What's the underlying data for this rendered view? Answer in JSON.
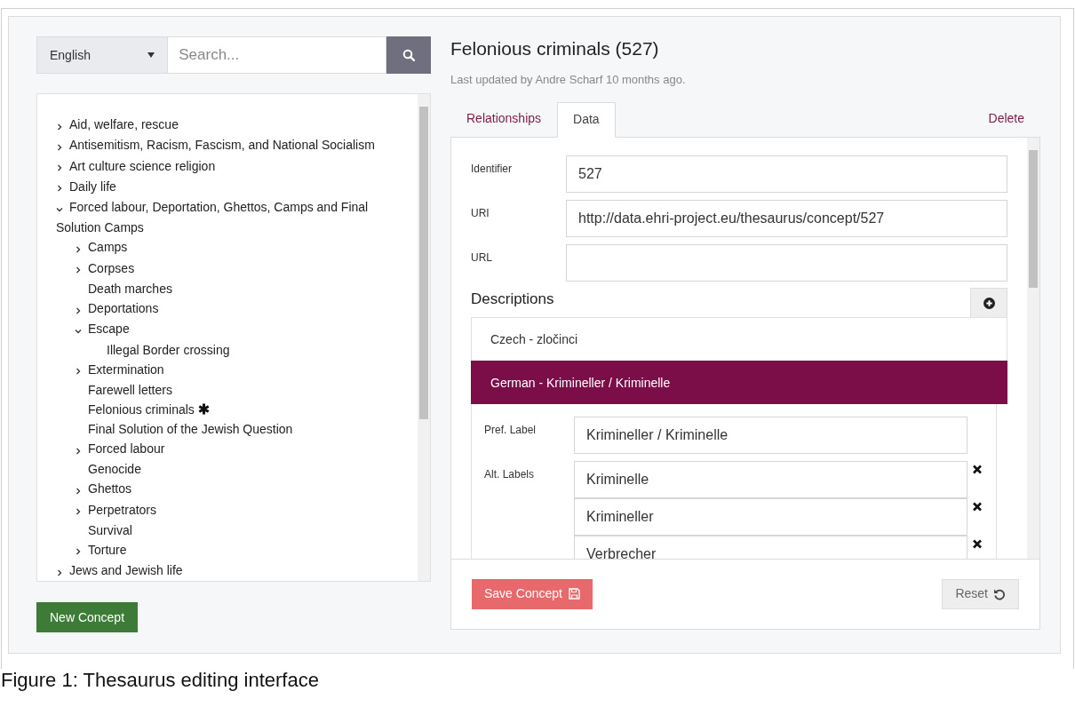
{
  "language_select": {
    "value": "English"
  },
  "search": {
    "placeholder": "Search..."
  },
  "tree": [
    {
      "label": "Aid, welfare, rescue",
      "expanded": false
    },
    {
      "label": "Antisemitism, Racism, Fascism, and National Socialism",
      "expanded": false
    },
    {
      "label": "Art culture science religion",
      "expanded": false
    },
    {
      "label": "Daily life",
      "expanded": false
    },
    {
      "label": "Forced labour, Deportation, Ghettos, Camps and Final Solution Camps",
      "expanded": true,
      "children": [
        {
          "label": "Camps",
          "expanded": false
        },
        {
          "label": "Corpses",
          "expanded": false
        },
        {
          "label": "Death marches"
        },
        {
          "label": "Deportations",
          "expanded": false
        },
        {
          "label": "Escape",
          "expanded": true,
          "children": [
            {
              "label": "Illegal Border crossing"
            }
          ]
        },
        {
          "label": "Extermination",
          "expanded": false
        },
        {
          "label": "Farewell letters"
        },
        {
          "label": "Felonious criminals",
          "current": true
        },
        {
          "label": "Final Solution of the Jewish Question"
        },
        {
          "label": "Forced labour",
          "expanded": false
        },
        {
          "label": "Genocide"
        },
        {
          "label": "Ghettos",
          "expanded": false
        },
        {
          "label": "Perpetrators",
          "expanded": false
        },
        {
          "label": "Survival"
        },
        {
          "label": "Torture",
          "expanded": false
        }
      ]
    },
    {
      "label": "Jews and Jewish life",
      "expanded": false
    }
  ],
  "new_concept_button": "New Concept",
  "concept": {
    "title": "Felonious criminals (527)",
    "updated": "Last updated by Andre Scharf 10 months ago."
  },
  "tabs": [
    {
      "label": "Relationships",
      "selected": false
    },
    {
      "label": "Data",
      "selected": true
    }
  ],
  "delete_link": "Delete",
  "fields": [
    {
      "label": "Identifier",
      "value": "527"
    },
    {
      "label": "URI",
      "value": "http://data.ehri-project.eu/thesaurus/concept/527"
    },
    {
      "label": "URL"
    }
  ],
  "descriptions": {
    "heading": "Descriptions",
    "items": [
      {
        "label": "Czech - zločinci",
        "selected": false
      },
      {
        "label": "German - Krimineller / Kriminelle",
        "selected": true,
        "pref_label": {
          "label": "Pref. Label",
          "value": "Krimineller / Kriminelle"
        },
        "alt_labels": {
          "label": "Alt. Labels",
          "values": [
            "Kriminelle",
            "Krimineller",
            "Verbrecher"
          ]
        }
      }
    ]
  },
  "save_button": "Save Concept",
  "reset_button": "Reset",
  "caption": "Figure 1: Thesaurus editing interface"
}
